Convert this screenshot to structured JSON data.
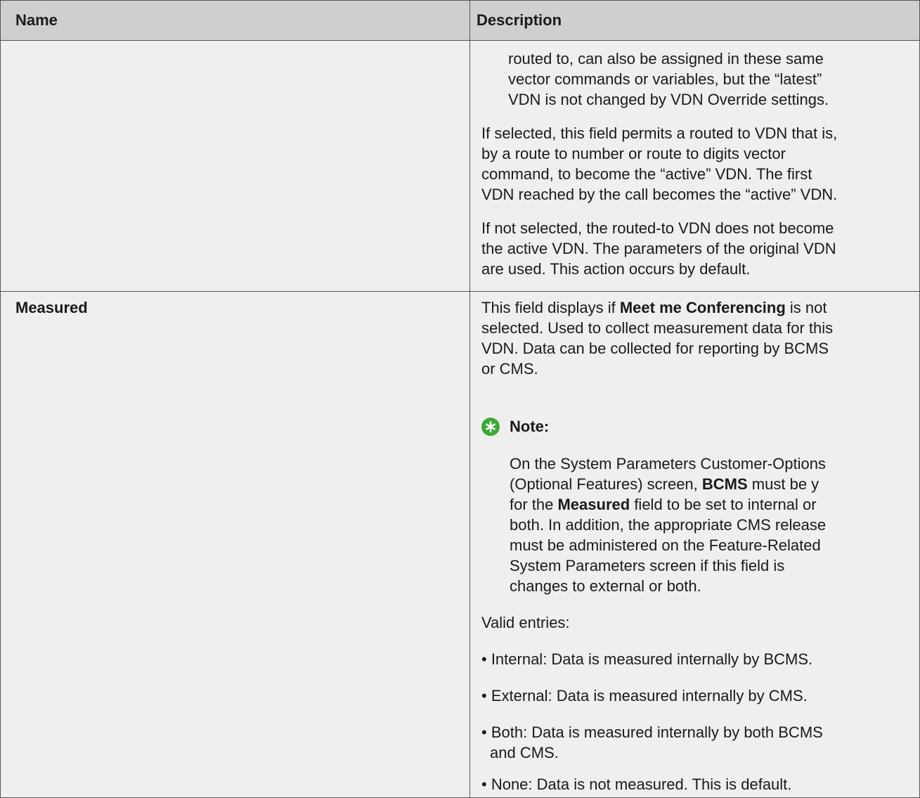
{
  "header": {
    "name": "Name",
    "description": "Description"
  },
  "row1": {
    "indented": [
      "routed to, can also be assigned in these same",
      "vector commands or variables, but the “latest”",
      "VDN is not changed by VDN Override settings."
    ],
    "para1": [
      "If selected, this field permits a routed to VDN that is,",
      "by a route to number or route to digits vector",
      "command, to become the “active” VDN. The first",
      "VDN reached by the call becomes the “active” VDN."
    ],
    "para2": [
      "If not selected, the routed-to VDN does not become",
      "the active VDN. The parameters of the original VDN",
      "are used. This action occurs by default."
    ]
  },
  "row2": {
    "name": "Measured",
    "intro": {
      "l1a": "This field displays if ",
      "l1b": "Meet me Conferencing",
      "l1c": " is not",
      "l2": "selected. Used to collect measurement data for this",
      "l3": "VDN. Data can be collected for reporting by BCMS",
      "l4": "or CMS."
    },
    "note": {
      "icon": "star-note-icon",
      "label": "Note:",
      "l1": "On the System Parameters Customer-Options",
      "l2a": "(Optional Features) screen, ",
      "l2b": "BCMS",
      "l2c": " must be y",
      "l3a": "for the ",
      "l3b": "Measured",
      "l3c": " field to be set to internal or",
      "l4": "both. In addition, the appropriate CMS release",
      "l5": "must be administered on the Feature-Related",
      "l6": "System Parameters screen if this field is",
      "l7": "changes to external or both."
    },
    "valid_label": "Valid entries:",
    "bullets": [
      "• Internal: Data is measured internally by BCMS.",
      "• External: Data is measured internally by CMS.",
      "• Both: Data is measured internally by both BCMS",
      "and CMS.",
      "• None: Data is not measured. This is default."
    ]
  },
  "colors": {
    "header_bg": "#cfcfcf",
    "cell_bg": "#efefef",
    "note_icon": "#3aaa35"
  }
}
